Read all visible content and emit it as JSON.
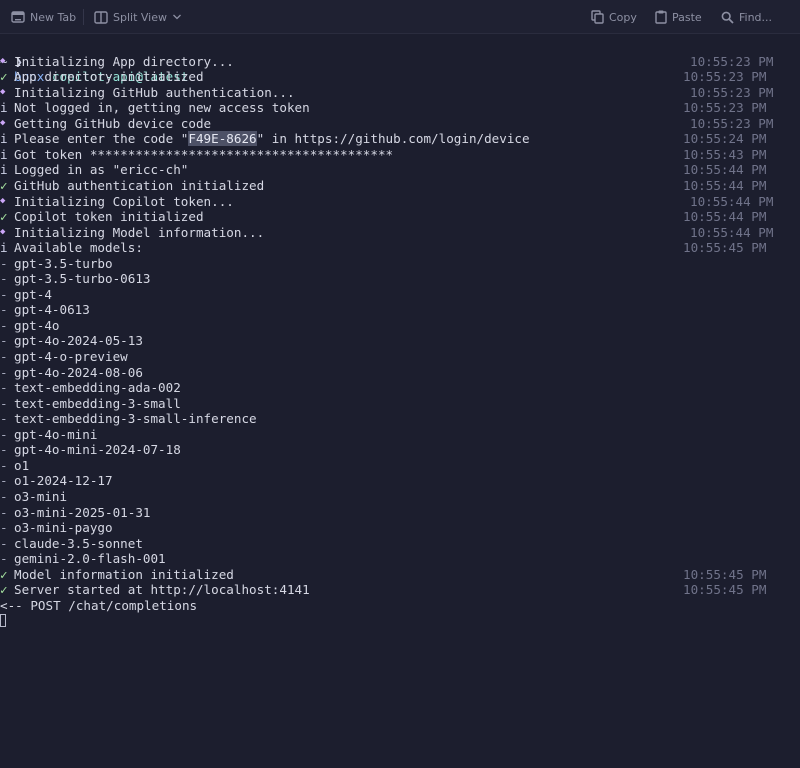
{
  "toolbar": {
    "new_tab": "New Tab",
    "split_view": "Split View",
    "copy": "Copy",
    "paste": "Paste",
    "find": "Find..."
  },
  "terminal": {
    "prompt_symbol": "~ ❯",
    "command": "bunx",
    "command_arg": "copilot-api@latest",
    "log_lines": [
      {
        "sym": "◆",
        "kind": "dot",
        "msg": "Initializing App directory...",
        "ts": "10:55:23 PM"
      },
      {
        "sym": "✓",
        "kind": "ok",
        "msg": "App directory initialized",
        "ts": "10:55:23 PM"
      },
      {
        "sym": "◆",
        "kind": "dot",
        "msg": "Initializing GitHub authentication...",
        "ts": "10:55:23 PM"
      },
      {
        "sym": "i",
        "kind": "info",
        "msg": "Not logged in, getting new access token",
        "ts": "10:55:23 PM"
      },
      {
        "sym": "◆",
        "kind": "dot",
        "msg": "Getting GitHub device code",
        "ts": "10:55:23 PM"
      },
      {
        "sym": "i",
        "kind": "info",
        "msg_pre": "Please enter the code \"",
        "code": "F49E-8626",
        "msg_post": "\" in https://github.com/login/device",
        "ts": "10:55:24 PM"
      },
      {
        "sym": "i",
        "kind": "info",
        "msg": "Got token ****************************************",
        "ts": "10:55:43 PM"
      },
      {
        "sym": "i",
        "kind": "info",
        "msg": "Logged in as \"ericc-ch\"",
        "ts": "10:55:44 PM"
      },
      {
        "sym": "✓",
        "kind": "ok",
        "msg": "GitHub authentication initialized",
        "ts": "10:55:44 PM"
      },
      {
        "sym": "◆",
        "kind": "dot",
        "msg": "Initializing Copilot token...",
        "ts": "10:55:44 PM"
      },
      {
        "sym": "✓",
        "kind": "ok",
        "msg": "Copilot token initialized",
        "ts": "10:55:44 PM"
      },
      {
        "sym": "◆",
        "kind": "dot",
        "msg": "Initializing Model information...",
        "ts": "10:55:44 PM"
      },
      {
        "sym": "i",
        "kind": "info",
        "msg": "Available models:",
        "ts": "10:55:45 PM"
      }
    ],
    "models": [
      "gpt-3.5-turbo",
      "gpt-3.5-turbo-0613",
      "gpt-4",
      "gpt-4-0613",
      "gpt-4o",
      "gpt-4o-2024-05-13",
      "gpt-4-o-preview",
      "gpt-4o-2024-08-06",
      "text-embedding-ada-002",
      "text-embedding-3-small",
      "text-embedding-3-small-inference",
      "gpt-4o-mini",
      "gpt-4o-mini-2024-07-18",
      "o1",
      "o1-2024-12-17",
      "o3-mini",
      "o3-mini-2025-01-31",
      "o3-mini-paygo",
      "claude-3.5-sonnet",
      "gemini-2.0-flash-001"
    ],
    "model_bullet": "-",
    "final_lines": [
      {
        "sym": "✓",
        "kind": "ok",
        "msg": "Model information initialized",
        "ts": "10:55:45 PM"
      },
      {
        "sym": "✓",
        "kind": "ok",
        "msg": "Server started at http://localhost:4141",
        "ts": "10:55:45 PM"
      }
    ],
    "request_line": "<-- POST /chat/completions",
    "colors": {
      "background": "#1c1e2e",
      "success": "#a6e3a1",
      "pending": "#cba6f7",
      "command": "#89b4fa",
      "command_arg": "#94e2d5"
    }
  }
}
